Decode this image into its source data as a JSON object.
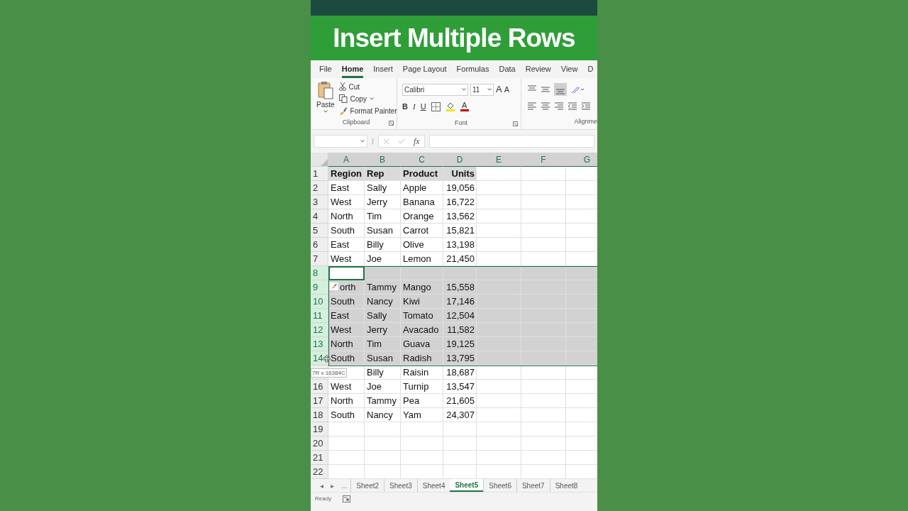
{
  "video_title": "Insert Multiple Rows",
  "ribbon_tabs": [
    {
      "label": "File",
      "selected": false
    },
    {
      "label": "Home",
      "selected": true
    },
    {
      "label": "Insert",
      "selected": false
    },
    {
      "label": "Page Layout",
      "selected": false
    },
    {
      "label": "Formulas",
      "selected": false
    },
    {
      "label": "Data",
      "selected": false
    },
    {
      "label": "Review",
      "selected": false
    },
    {
      "label": "View",
      "selected": false
    },
    {
      "label": "D",
      "selected": false
    }
  ],
  "clipboard": {
    "paste": "Paste",
    "cut": "Cut",
    "copy": "Copy",
    "format_painter": "Format Painter",
    "group_label": "Clipboard"
  },
  "font": {
    "name": "Calibri",
    "size": "11",
    "grow": "A",
    "shrink": "A",
    "bold": "B",
    "italic": "I",
    "underline": "U",
    "font_color": "A",
    "group_label": "Font"
  },
  "alignment": {
    "group_label": "Alignme"
  },
  "formula_bar": {
    "fx": "fx"
  },
  "columns": [
    "A",
    "B",
    "C",
    "D",
    "E",
    "F",
    "G"
  ],
  "rows": [
    {
      "num": "1",
      "kind": "header",
      "selected": false,
      "active": false,
      "region": "Region",
      "rep": "Rep",
      "product": "Product",
      "units": "Units"
    },
    {
      "num": "2",
      "kind": "data",
      "selected": false,
      "active": false,
      "region": "East",
      "rep": "Sally",
      "product": "Apple",
      "units": "19,056"
    },
    {
      "num": "3",
      "kind": "data",
      "selected": false,
      "active": false,
      "region": "West",
      "rep": "Jerry",
      "product": "Banana",
      "units": "16,722"
    },
    {
      "num": "4",
      "kind": "data",
      "selected": false,
      "active": false,
      "region": "North",
      "rep": "Tim",
      "product": "Orange",
      "units": "13,562"
    },
    {
      "num": "5",
      "kind": "data",
      "selected": false,
      "active": false,
      "region": "South",
      "rep": "Susan",
      "product": "Carrot",
      "units": "15,821"
    },
    {
      "num": "6",
      "kind": "data",
      "selected": false,
      "active": false,
      "region": "East",
      "rep": "Billy",
      "product": "Olive",
      "units": "13,198"
    },
    {
      "num": "7",
      "kind": "data",
      "selected": false,
      "active": false,
      "region": "West",
      "rep": "Joe",
      "product": "Lemon",
      "units": "21,450"
    },
    {
      "num": "8",
      "kind": "empty",
      "selected": true,
      "active": true
    },
    {
      "num": "9",
      "kind": "data",
      "selected": true,
      "active": false,
      "region": "orth",
      "rep": "Tammy",
      "product": "Mango",
      "units": "15,558"
    },
    {
      "num": "10",
      "kind": "data",
      "selected": true,
      "active": false,
      "region": "South",
      "rep": "Nancy",
      "product": "Kiwi",
      "units": "17,146"
    },
    {
      "num": "11",
      "kind": "data",
      "selected": true,
      "active": false,
      "region": "East",
      "rep": "Sally",
      "product": "Tomato",
      "units": "12,504"
    },
    {
      "num": "12",
      "kind": "data",
      "selected": true,
      "active": false,
      "region": "West",
      "rep": "Jerry",
      "product": "Avacado",
      "units": "11,582"
    },
    {
      "num": "13",
      "kind": "data",
      "selected": true,
      "active": false,
      "region": "North",
      "rep": "Tim",
      "product": "Guava",
      "units": "19,125"
    },
    {
      "num": "14",
      "kind": "data",
      "selected": true,
      "active": false,
      "region": "South",
      "rep": "Susan",
      "product": "Radish",
      "units": "13,795"
    },
    {
      "kind": "data",
      "selected": false,
      "active": false,
      "rep": "Billy",
      "product": "Raisin",
      "units": "18,687"
    },
    {
      "num": "16",
      "kind": "data",
      "selected": false,
      "active": false,
      "region": "West",
      "rep": "Joe",
      "product": "Turnip",
      "units": "13,547"
    },
    {
      "num": "17",
      "kind": "data",
      "selected": false,
      "active": false,
      "region": "North",
      "rep": "Tammy",
      "product": "Pea",
      "units": "21,605"
    },
    {
      "num": "18",
      "kind": "data",
      "selected": false,
      "active": false,
      "region": "South",
      "rep": "Nancy",
      "product": "Yam",
      "units": "24,307"
    },
    {
      "num": "19",
      "kind": "empty",
      "selected": false,
      "active": false
    },
    {
      "num": "20",
      "kind": "empty",
      "selected": false,
      "active": false
    },
    {
      "num": "21",
      "kind": "empty",
      "selected": false,
      "active": false
    },
    {
      "num": "22",
      "kind": "empty",
      "selected": false,
      "active": false
    }
  ],
  "selection_tooltip": "7R x 16384C",
  "sheet_nav": {
    "prev": "◂",
    "next": "▸",
    "more": "..."
  },
  "sheets": [
    {
      "label": "Sheet2",
      "selected": false
    },
    {
      "label": "Sheet3",
      "selected": false
    },
    {
      "label": "Sheet4",
      "selected": false
    },
    {
      "label": "Sheet5",
      "selected": true
    },
    {
      "label": "Sheet6",
      "selected": false
    },
    {
      "label": "Sheet7",
      "selected": false
    },
    {
      "label": "Sheet8",
      "selected": false
    }
  ],
  "status": "Ready"
}
